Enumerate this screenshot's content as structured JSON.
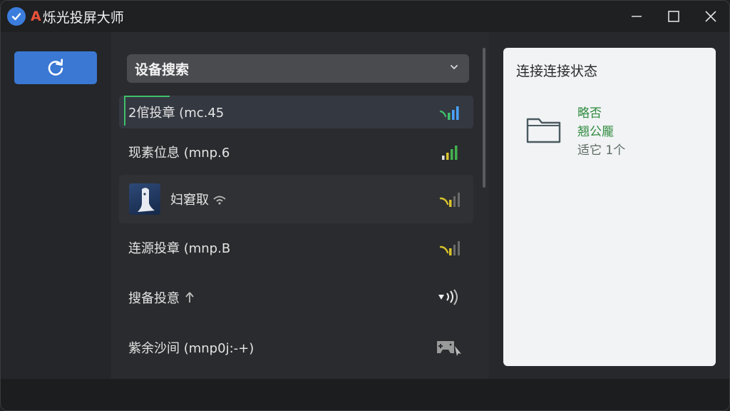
{
  "app": {
    "title_letter": "A",
    "title": "烁光投屏大师"
  },
  "search": {
    "label": "设备搜索"
  },
  "devices": [
    {
      "name": "2倌投章 (mc.45",
      "signal_color": "#4aa3ff",
      "signal_bars": 4,
      "selected": true
    },
    {
      "name": "现素位息 (mnp.6",
      "signal_color": "#43b24f",
      "signal_bars": 4,
      "selected": false
    },
    {
      "name": "妇窘取",
      "signal_color": "#d7c22b",
      "signal_bars": 3,
      "selected": false
    },
    {
      "name": "连源投章 (mnp.B",
      "signal_color": "#d7c22b",
      "signal_bars": 3,
      "selected": false
    },
    {
      "name": "搜备投意",
      "signal_color": "#e6e6e6",
      "signal_bars": 3,
      "selected": false
    },
    {
      "name": "紫余沙间 (mnp0j:-+)",
      "signal_color": "#bfbfbf",
      "signal_bars": 0,
      "selected": false
    }
  ],
  "status_panel": {
    "title": "连接连接状态",
    "line1": "略否",
    "line2": "翘公龎",
    "line3": "适它 1个"
  },
  "colors": {
    "accent_blue": "#3a78d4",
    "accent_green": "#3fc06b",
    "title_red": "#e8533a"
  }
}
